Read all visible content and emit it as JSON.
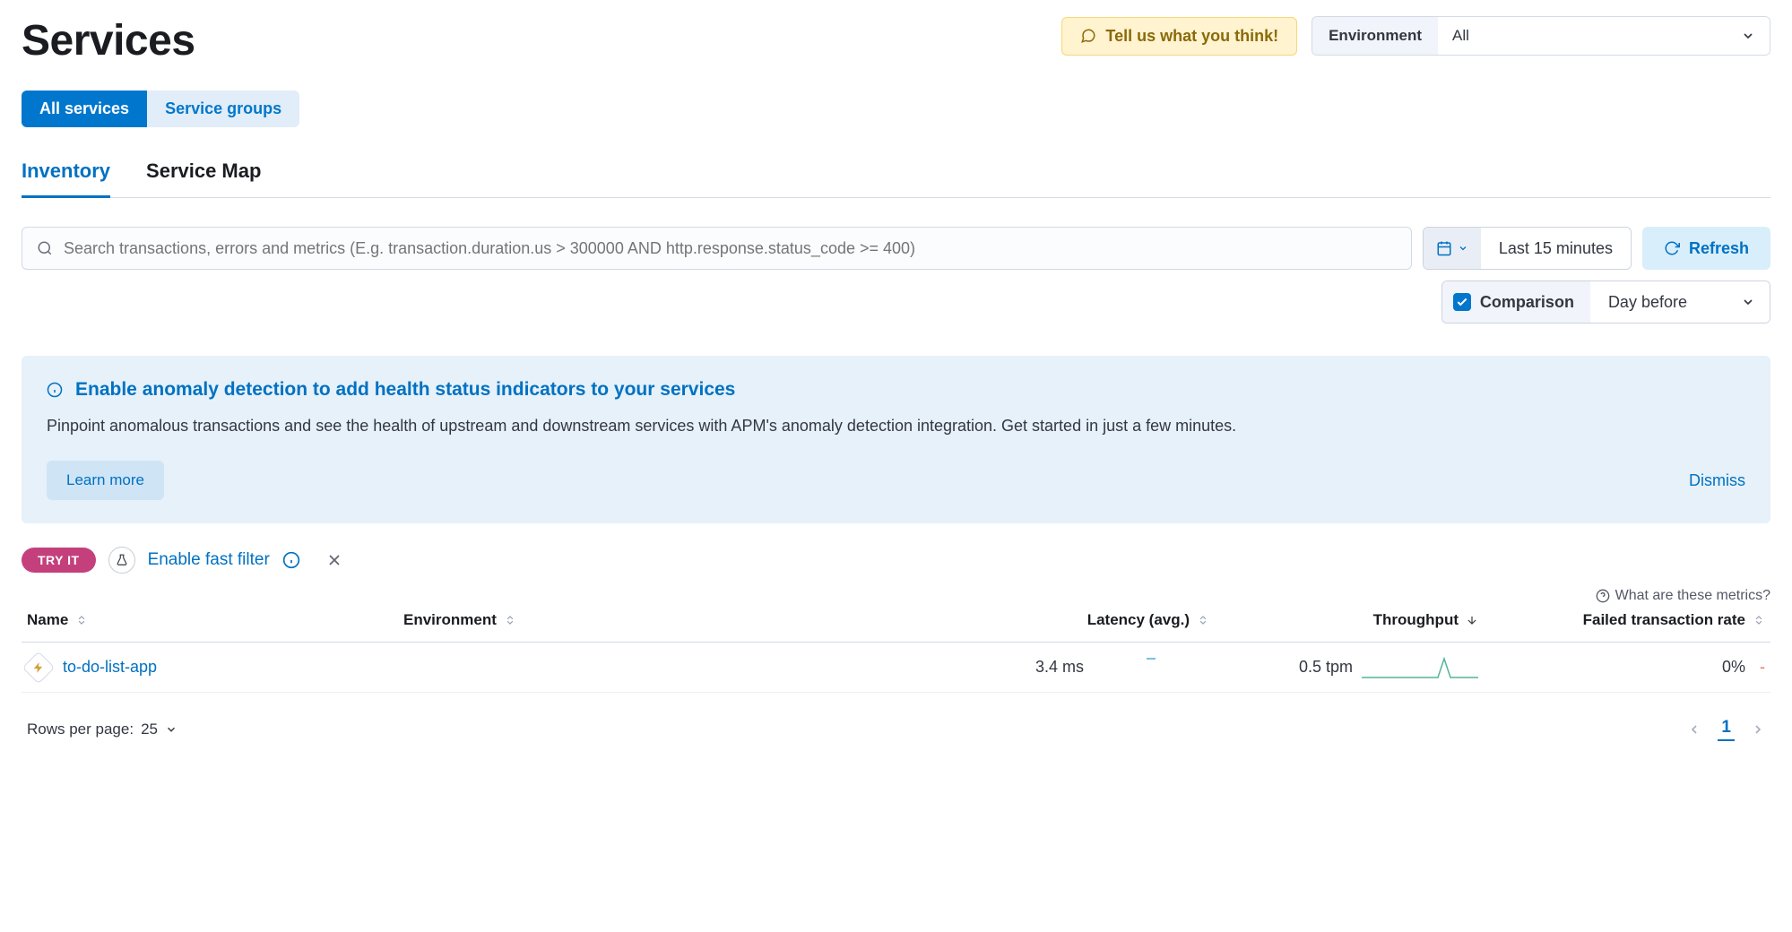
{
  "header": {
    "title": "Services",
    "feedback_label": "Tell us what you think!",
    "env_label": "Environment",
    "env_value": "All"
  },
  "pill_tabs": {
    "all_services": "All services",
    "service_groups": "Service groups"
  },
  "sec_tabs": {
    "inventory": "Inventory",
    "service_map": "Service Map"
  },
  "search": {
    "placeholder": "Search transactions, errors and metrics (E.g. transaction.duration.us > 300000 AND http.response.status_code >= 400)"
  },
  "time": {
    "range": "Last 15 minutes",
    "refresh": "Refresh"
  },
  "comparison": {
    "label": "Comparison",
    "value": "Day before"
  },
  "callout": {
    "title": "Enable anomaly detection to add health status indicators to your services",
    "body": "Pinpoint anomalous transactions and see the health of upstream and downstream services with APM's anomaly detection integration. Get started in just a few minutes.",
    "learn": "Learn more",
    "dismiss": "Dismiss"
  },
  "fast_filter": {
    "try_it": "TRY IT",
    "label": "Enable fast filter"
  },
  "metrics_help": "What are these metrics?",
  "table": {
    "headers": {
      "name": "Name",
      "environment": "Environment",
      "latency": "Latency (avg.)",
      "throughput": "Throughput",
      "failed": "Failed transaction rate"
    },
    "rows": [
      {
        "name": "to-do-list-app",
        "environment": "",
        "latency": "3.4 ms",
        "throughput": "0.5 tpm",
        "failed": "0%"
      }
    ]
  },
  "footer": {
    "rows_per_page_label": "Rows per page:",
    "rows_per_page_value": "25",
    "page": "1"
  },
  "chart_data": {
    "latency_sparkline": {
      "type": "line",
      "values": [
        3.4
      ],
      "color": "#7abfe8"
    },
    "throughput_sparkline": {
      "type": "line",
      "values": [
        0,
        0,
        0,
        0,
        0,
        0,
        0,
        0.1,
        1.8,
        0.1,
        0,
        0
      ],
      "color": "#54b399"
    },
    "failed_sparkline": {
      "type": "line",
      "values": [],
      "color": "#e07a5f"
    }
  }
}
